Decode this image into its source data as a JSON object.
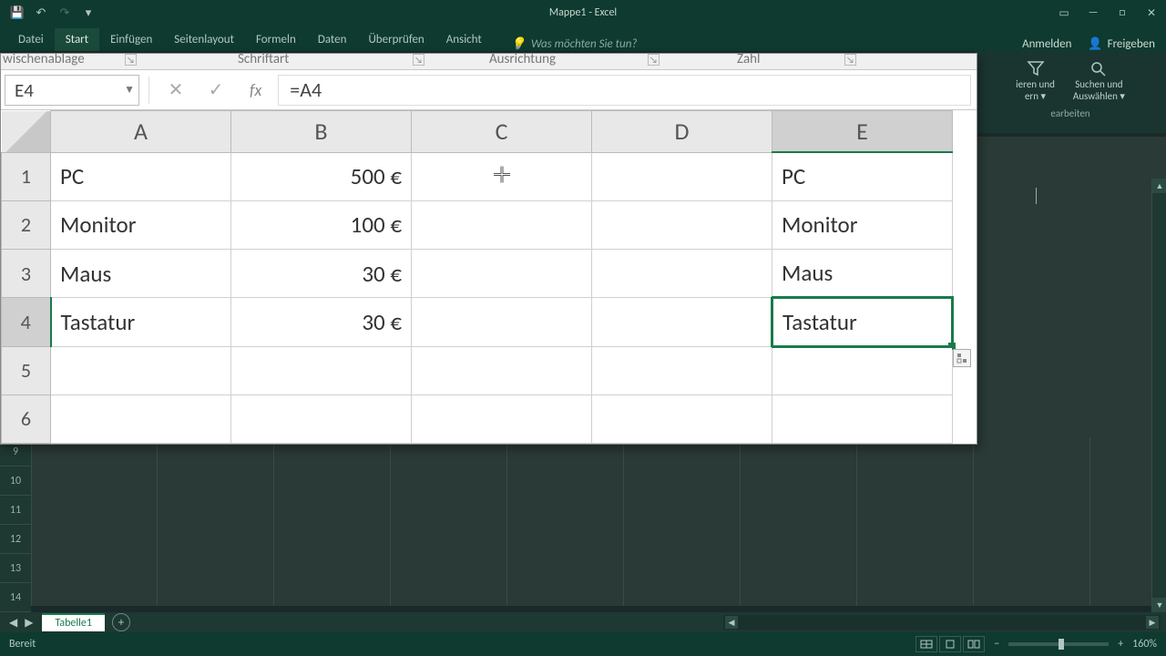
{
  "titlebar": {
    "title": "Mappe1 - Excel"
  },
  "qat": {
    "save": "💾",
    "undo": "↶",
    "redo": "↷",
    "custom": "▾"
  },
  "win": {
    "ribbon_opts": "▭",
    "min": "—",
    "max": "□",
    "close": "✕"
  },
  "tabs": {
    "datei": "Datei",
    "start": "Start",
    "einfuegen": "Einfügen",
    "seitenlayout": "Seitenlayout",
    "formeln": "Formeln",
    "daten": "Daten",
    "ueberpruefen": "Überprüfen",
    "ansicht": "Ansicht",
    "tellme": "Was möchten Sie tun?",
    "anmelden": "Anmelden",
    "freigeben": "Freigeben"
  },
  "ribbon_right": {
    "item1a": "ieren und",
    "item1b": "ern ▾",
    "item2a": "Suchen und",
    "item2b": "Auswählen ▾",
    "group": "earbeiten"
  },
  "zoom_ribbon": {
    "g1": "wischenablage",
    "g2": "Schriftart",
    "g3": "Ausrichtung",
    "g4": "Zahl"
  },
  "name_box": "E4",
  "fb": {
    "cancel": "✕",
    "enter": "✓",
    "fx": "fx"
  },
  "formula": "=A4",
  "cols": {
    "A": "A",
    "B": "B",
    "C": "C",
    "D": "D",
    "E": "E"
  },
  "col_widths": {
    "A": 198,
    "B": 198,
    "C": 198,
    "D": 198,
    "E": 198
  },
  "rows": [
    "1",
    "2",
    "3",
    "4",
    "5",
    "6"
  ],
  "cells": {
    "A1": "PC",
    "B1": "500 €",
    "E1": "PC",
    "A2": "Monitor",
    "B2": "100 €",
    "E2": "Monitor",
    "A3": "Maus",
    "B3": "30 €",
    "E3": "Maus",
    "A4": "Tastatur",
    "B4": "30 €",
    "E4": "Tastatur"
  },
  "bg_rows": [
    "9",
    "10",
    "11",
    "12",
    "13",
    "14"
  ],
  "sheet_tab": "Tabelle1",
  "status": {
    "ready": "Bereit",
    "zoom": "160%",
    "minus": "−",
    "plus": "+"
  }
}
